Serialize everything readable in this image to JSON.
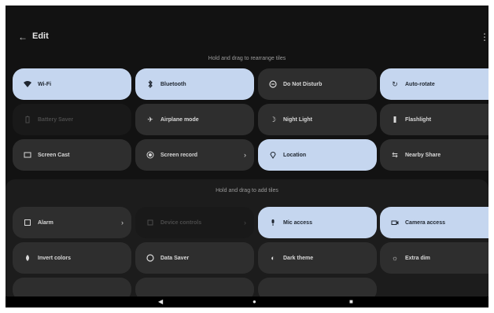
{
  "header": {
    "title": "Edit",
    "back_icon": "arrow-back-icon",
    "more_icon": "more-vert-icon"
  },
  "hints": {
    "rearrange": "Hold and drag to rearrange tiles",
    "add": "Hold and drag to add tiles"
  },
  "active_tiles": [
    {
      "label": "Wi-Fi",
      "icon": "wifi-icon",
      "state": "on"
    },
    {
      "label": "Bluetooth",
      "icon": "bluetooth-icon",
      "state": "on"
    },
    {
      "label": "Do Not Disturb",
      "icon": "dnd-icon",
      "state": "off"
    },
    {
      "label": "Auto-rotate",
      "icon": "rotate-icon",
      "state": "on"
    },
    {
      "label": "Battery Saver",
      "icon": "battery-icon",
      "state": "dim"
    },
    {
      "label": "Airplane mode",
      "icon": "airplane-icon",
      "state": "off"
    },
    {
      "label": "Night Light",
      "icon": "night-light-icon",
      "state": "off"
    },
    {
      "label": "Flashlight",
      "icon": "flashlight-icon",
      "state": "off"
    },
    {
      "label": "Screen Cast",
      "icon": "cast-icon",
      "state": "off"
    },
    {
      "label": "Screen record",
      "icon": "record-icon",
      "state": "off"
    },
    {
      "label": "Location",
      "icon": "location-icon",
      "state": "on"
    },
    {
      "label": "Nearby Share",
      "icon": "share-icon",
      "state": "off"
    }
  ],
  "available_tiles": [
    {
      "label": "Alarm",
      "icon": "alarm-icon",
      "state": "off"
    },
    {
      "label": "Device controls",
      "icon": "device-controls-icon",
      "state": "dim"
    },
    {
      "label": "Mic access",
      "icon": "mic-icon",
      "state": "on"
    },
    {
      "label": "Camera access",
      "icon": "camera-icon",
      "state": "on"
    },
    {
      "label": "Invert colors",
      "icon": "invert-colors-icon",
      "state": "off"
    },
    {
      "label": "Data Saver",
      "icon": "data-saver-icon",
      "state": "off"
    },
    {
      "label": "Dark theme",
      "icon": "dark-theme-icon",
      "state": "off"
    },
    {
      "label": "Extra dim",
      "icon": "extra-dim-icon",
      "state": "off"
    }
  ],
  "nav": {
    "back": "back-nav-icon",
    "home": "home-nav-icon",
    "recents": "recents-nav-icon"
  }
}
